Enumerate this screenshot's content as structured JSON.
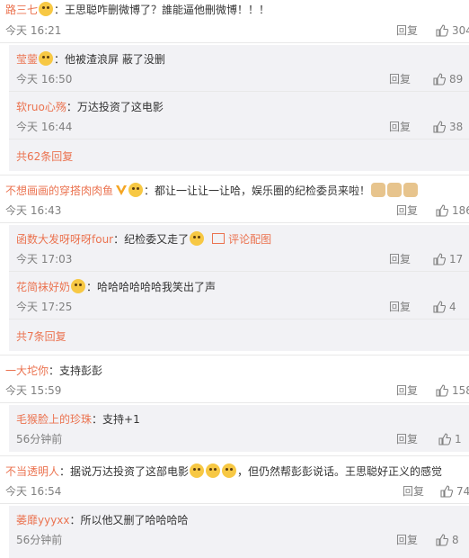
{
  "c1": {
    "user": "路三七",
    "text": "：王思聪咋删微博了？誰能逼他刪微博！！！",
    "time": "今天 16:21",
    "reply": "回复",
    "likes": "304"
  },
  "c1s1": {
    "user": "莹蓥",
    "text": "：他被渣浪屏 蔽了没删",
    "time": "今天 16:50",
    "reply": "回复",
    "likes": "89"
  },
  "c1s2": {
    "user": "软ruo心殇",
    "text": "：万达投资了这电影",
    "time": "今天 16:44",
    "reply": "回复",
    "likes": "38"
  },
  "c1more": "共62条回复",
  "c2": {
    "user": "不想画画的穿搭肉肉鱼",
    "text": "：都让一让让一让哈，娱乐圈的纪检委员来啦！",
    "time": "今天 16:43",
    "reply": "回复",
    "likes": "186"
  },
  "c2s1": {
    "user": "函数大发呀呀呀four",
    "text": "：纪检委又走了",
    "pic": "评论配图",
    "time": "今天 17:03",
    "reply": "回复",
    "likes": "17"
  },
  "c2s2": {
    "user": "花简袜好奶",
    "text": "：哈哈哈哈哈哈我笑出了声",
    "time": "今天 17:25",
    "reply": "回复",
    "likes": "4"
  },
  "c2more": "共7条回复",
  "c3": {
    "user": "一大坨你",
    "text": "：支持彭彭",
    "time": "今天 15:59",
    "reply": "回复",
    "likes": "158"
  },
  "c3s1": {
    "user": "毛猴脸上的珍珠",
    "text": "：支持+1",
    "time": "56分钟前",
    "reply": "回复",
    "likes": "1"
  },
  "c4": {
    "user": "不当透明人",
    "text1": "：据说万达投资了这部电影",
    "text2": "，但仍然帮彭彭说话。王思聪好正义的感觉",
    "time": "今天 16:54",
    "reply": "回复",
    "likes": "74"
  },
  "c4s1": {
    "user": "萎靡yyyxx",
    "text": "：所以他又删了哈哈哈哈",
    "time": "56分钟前",
    "reply": "回复",
    "likes": "8"
  }
}
